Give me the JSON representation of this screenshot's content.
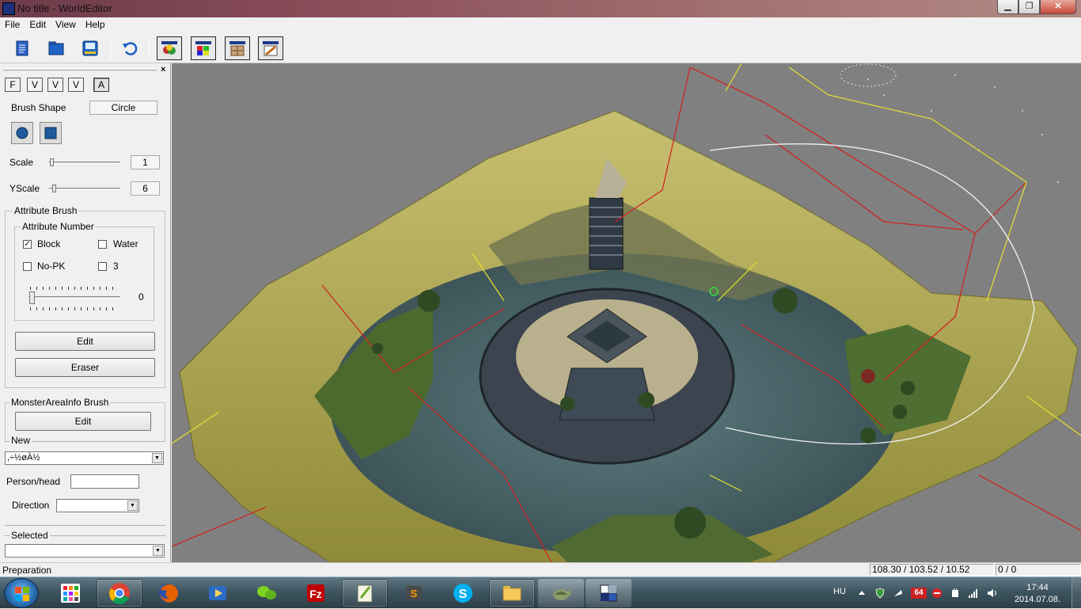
{
  "window": {
    "title": "No title - WorldEditor",
    "buttons": {
      "minimize": "▁",
      "maximize": "❐",
      "close": "✕"
    }
  },
  "menu": [
    "File",
    "Edit",
    "View",
    "Help"
  ],
  "toolbar": {
    "icons": [
      "new-document-icon",
      "open-folder-icon",
      "save-icon",
      "undo-icon",
      "texture-palette-icon",
      "color-palette-icon",
      "attribute-grid-icon",
      "brush-edit-icon"
    ]
  },
  "panel": {
    "close": "×",
    "modes": [
      "F",
      "V",
      "V",
      "V",
      "A"
    ],
    "brush_shape_label": "Brush Shape",
    "brush_shape_value": "Circle",
    "scale_label": "Scale",
    "scale_value": "1",
    "yscale_label": "YScale",
    "yscale_value": "6",
    "attribute_brush_title": "Attribute Brush",
    "attribute_number_title": "Attribute Number",
    "block_label": "Block",
    "block_checked": true,
    "water_label": "Water",
    "nopk_label": "No-PK",
    "three_label": "3",
    "attribute_slider_value": "0",
    "edit_button": "Edit",
    "eraser_button": "Eraser",
    "monster_title": "MonsterAreaInfo Brush",
    "monster_edit_button": "Edit",
    "new_label": "New",
    "new_combo_value": ",÷½øÀ½",
    "person_head_label": "Person/head",
    "direction_label": "Direction",
    "selected_label": "Selected"
  },
  "status": {
    "text": "Preparation",
    "coords": "108.30 / 103.52 / 10.52",
    "counter": "0 / 0"
  },
  "taskbar": {
    "apps": [
      "start-menu-tiles",
      "chrome",
      "firefox",
      "media-player",
      "messenger",
      "filezilla",
      "notepad-plus-plus",
      "sublime-text",
      "skype",
      "file-explorer",
      "turtle-app",
      "worldeditor"
    ],
    "language": "HU",
    "tray_badge": "64",
    "time": "17:44",
    "date": "2014.07.08."
  },
  "colors": {
    "titlebar": "#8a4d5a",
    "viewport_bg": "#808080",
    "terrain": "#b7ad4c",
    "water": "#4f6b70",
    "grid_red": "#d21e1e",
    "grid_yellow": "#e6e030"
  }
}
